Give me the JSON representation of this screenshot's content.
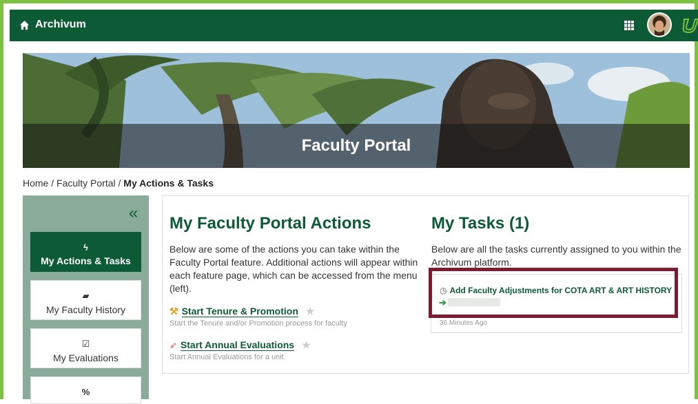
{
  "app": {
    "name": "Archivum"
  },
  "icons": [
    "home-icon",
    "apps-grid-icon",
    "user-avatar",
    "usf-logo-icon",
    "collapse-icon",
    "bolt-icon",
    "book-icon",
    "calendar-check-icon",
    "percent-icon",
    "gavel-icon",
    "paper-plane-icon",
    "star-icon",
    "clock-icon",
    "arrow-right-icon"
  ],
  "colors": {
    "brand_green": "#0d5a36",
    "accent_green": "#7dc241",
    "highlight": "#7b1c33",
    "sidebar": "#8aab9a"
  },
  "banner": {
    "title": "Faculty Portal"
  },
  "breadcrumb": {
    "home": "Home",
    "sep": " / ",
    "portal": "Faculty Portal",
    "current": "My Actions & Tasks"
  },
  "sidebar": {
    "collapse": "«",
    "items": [
      {
        "label": "My Actions & Tasks",
        "icon": "ϟ",
        "active": true
      },
      {
        "label": "My Faculty History",
        "icon": "▰",
        "active": false
      },
      {
        "label": "My Evaluations",
        "icon": "☑",
        "active": false
      },
      {
        "label": "",
        "icon": "%",
        "active": false
      }
    ]
  },
  "actions": {
    "title": "My Faculty Portal Actions",
    "intro": "Below are some of the actions you can take within the Faculty Portal feature. Additional actions will appear within each feature page, which can be accessed from the menu (left).",
    "items": [
      {
        "label": "Start Tenure & Promotion",
        "desc": "Start the Tenure and/or Promotion process for faculty"
      },
      {
        "label": "Start Annual Evaluations",
        "desc": "Start Annual Evaluations for a unit"
      }
    ]
  },
  "tasks": {
    "title": "My Tasks (1)",
    "intro": "Below are all the tasks currently assigned to you within the Archivum platform.",
    "items": [
      {
        "label": "Add Faculty Adjustments for COTA ART & ART HISTORY",
        "time": "36 Minutes Ago"
      }
    ]
  }
}
